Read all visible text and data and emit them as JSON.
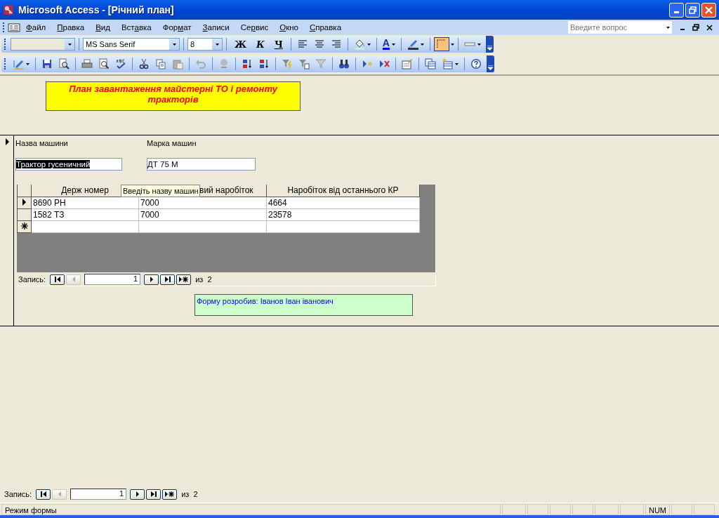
{
  "window": {
    "title": "Microsoft Access - [Річний план]"
  },
  "menu": [
    {
      "mnemonic": "Ф",
      "after": "айл"
    },
    {
      "mnemonic": "П",
      "after": "равка"
    },
    {
      "mnemonic": "В",
      "after": "ид"
    },
    {
      "before": "Вст",
      "mnemonic": "а",
      "after": "вка"
    },
    {
      "before": "Фор",
      "mnemonic": "м",
      "after": "ат"
    },
    {
      "mnemonic": "З",
      "after": "аписи"
    },
    {
      "before": "Се",
      "mnemonic": "р",
      "after": "вис"
    },
    {
      "mnemonic": "О",
      "after": "кно"
    },
    {
      "mnemonic": "С",
      "after": "правка"
    }
  ],
  "help_box": {
    "placeholder": "Введите вопрос"
  },
  "format_toolbar": {
    "font": "MS Sans Serif",
    "size": "8",
    "style_buttons": [
      "Ж",
      "К",
      "Ч"
    ],
    "font_color_button": "A"
  },
  "form": {
    "title": "План завантаження майстерні ТО і ремонту тракторів",
    "fields": [
      {
        "label": "Назва машини",
        "value": "Трактор гусеничний",
        "text_selected": true
      },
      {
        "label": "Марка машин",
        "value": "ДТ 75 М",
        "text_selected": false
      }
    ],
    "subform": {
      "columns": [
        "Держ номер",
        "вий наробіток",
        "Наробіток від останнього КР"
      ],
      "rows": [
        {
          "cells": [
            "8690 РН",
            "7000",
            "4664"
          ],
          "current": true
        },
        {
          "cells": [
            "1582 ТЗ",
            "7000",
            "23578"
          ],
          "current": false
        }
      ],
      "tooltip": "Введіть назву машин",
      "navigator": {
        "label": "Запись:",
        "record": "1",
        "total": "из  2"
      }
    },
    "author_note": "Форму розробив: Іванов Іван іванович"
  },
  "navigator": {
    "label": "Запись:",
    "record": "1",
    "total": "из  2"
  },
  "status_bar": {
    "mode": "Режим формы",
    "num": "NUM"
  }
}
